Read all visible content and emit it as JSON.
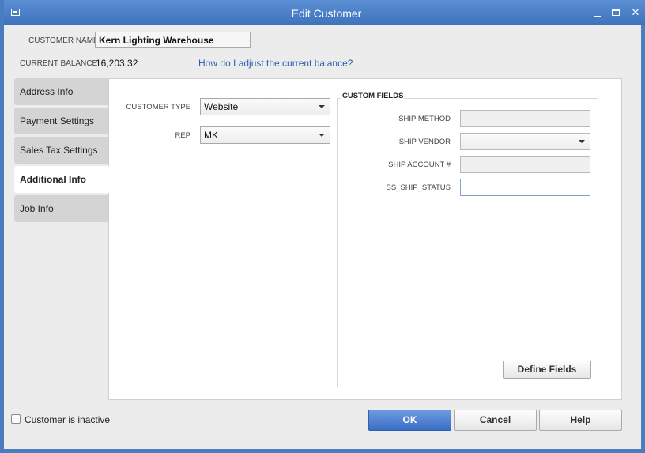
{
  "window": {
    "title": "Edit Customer"
  },
  "header": {
    "customer_name_label": "CUSTOMER NAME",
    "customer_name_value": "Kern Lighting Warehouse",
    "current_balance_label": "CURRENT BALANCE",
    "current_balance_value": "16,203.32",
    "adjust_balance_link": "How do I adjust the current balance?"
  },
  "tabs": [
    {
      "label": "Address Info"
    },
    {
      "label": "Payment Settings"
    },
    {
      "label": "Sales Tax Settings"
    },
    {
      "label": "Additional Info",
      "active": true
    },
    {
      "label": "Job Info"
    }
  ],
  "additional_info": {
    "customer_type_label": "CUSTOMER TYPE",
    "customer_type_value": "Website",
    "rep_label": "REP",
    "rep_value": "MK"
  },
  "custom_fields": {
    "title": "CUSTOM FIELDS",
    "fields": [
      {
        "label": "SHIP METHOD",
        "value": ""
      },
      {
        "label": "SHIP VENDOR",
        "value": ""
      },
      {
        "label": "SHIP ACCOUNT #",
        "value": ""
      },
      {
        "label": "SS_SHIP_STATUS",
        "value": ""
      }
    ],
    "define_fields_label": "Define Fields"
  },
  "footer": {
    "inactive_label": "Customer is inactive",
    "inactive_checked": false,
    "ok_label": "OK",
    "cancel_label": "Cancel",
    "help_label": "Help"
  },
  "colors": {
    "titlebar": "#4a80c8",
    "primary_button": "#3a6ec6",
    "link": "#2a5db0"
  },
  "icons": [
    "system-menu-icon",
    "minimize-icon",
    "maximize-icon",
    "close-icon",
    "dropdown-arrow-icon"
  ]
}
